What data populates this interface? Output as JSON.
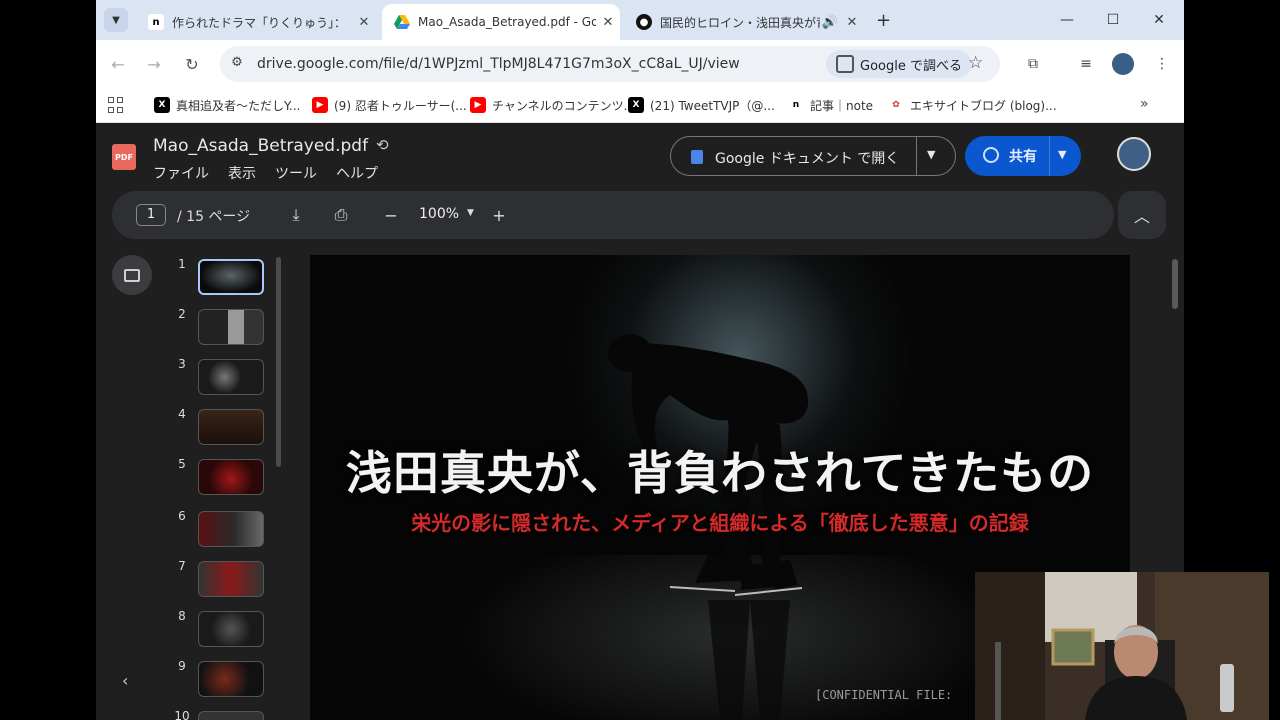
{
  "browser": {
    "tabs": [
      {
        "title": "作られたドラマ「りくりゅう」：",
        "favicon": "note-icon",
        "active": false
      },
      {
        "title": "Mao_Asada_Betrayed.pdf - Goo",
        "favicon": "google-drive-icon",
        "active": true
      },
      {
        "title": "国民的ヒロイン・浅田真央が背",
        "favicon": "audio-tab-icon",
        "active": false
      }
    ],
    "address": "drive.google.com/file/d/1WPJzml_TlpMJ8L471G7m3oX_cC8aL_UJ/view",
    "google_lens_label": "Google で調べる",
    "bookmarks": [
      {
        "label": "真相追及者～ただしY...",
        "icon": "x-icon"
      },
      {
        "label": "(9) 忍者トゥルーサー(...",
        "icon": "youtube-icon"
      },
      {
        "label": "チャンネルのコンテンツ...",
        "icon": "youtube-icon"
      },
      {
        "label": "(21) TweetTVJP（@...",
        "icon": "x-icon"
      },
      {
        "label": "記事｜note",
        "icon": "note-icon"
      },
      {
        "label": "エキサイトブログ (blog)...",
        "icon": "excite-icon"
      }
    ]
  },
  "drive": {
    "file_badge": "PDF",
    "file_name": "Mao_Asada_Betrayed.pdf",
    "menu": [
      "ファイル",
      "表示",
      "ツール",
      "ヘルプ"
    ],
    "open_with_label": "Google ドキュメント で開く",
    "share_label": "共有"
  },
  "pdf_toolbar": {
    "current_page": "1",
    "page_total": "/ 15 ページ",
    "zoom": "100%"
  },
  "thumbnails": [
    "1",
    "2",
    "3",
    "4",
    "5",
    "6",
    "7",
    "8",
    "9",
    "10"
  ],
  "page": {
    "headline": "浅田真央が、背負わされてきたもの",
    "subheadline": "栄光の影に隠された、メディアと組織による「徹底した悪意」の記録",
    "footer_text": "[CONFIDENTIAL FILE: "
  }
}
